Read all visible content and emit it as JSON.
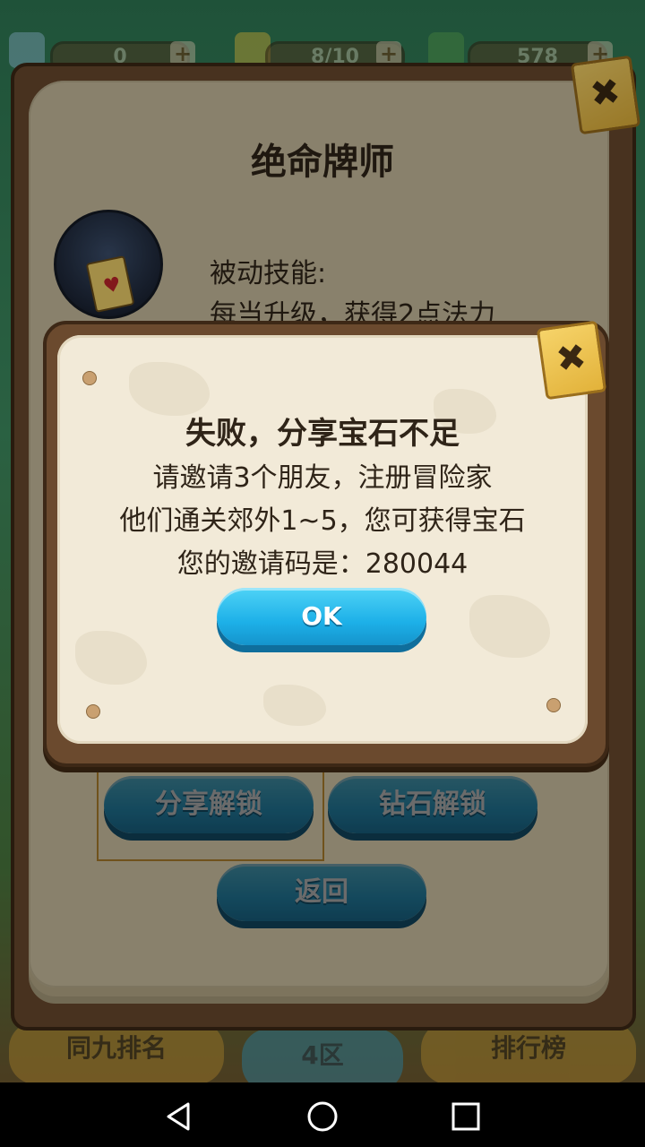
{
  "topbar": {
    "gems": "0",
    "energy": "8/10",
    "cash": "578",
    "plus": "+"
  },
  "bottom_tabs": {
    "left": "同九排名",
    "middle": "4区",
    "right": "排行榜"
  },
  "book": {
    "title": "绝命牌师",
    "skill_label": "被动技能:",
    "skill_desc": "每当升级，获得2点法力",
    "share_unlock": "分享解锁",
    "diamond_unlock": "钻石解锁",
    "back": "返回",
    "close_icon": "close-icon"
  },
  "dialog": {
    "title": "失败，分享宝石不足",
    "line1": "请邀请3个朋友，注册冒险家",
    "line2": "他们通关郊外1~5，您可获得宝石",
    "line3": "您的邀请码是：280044",
    "ok": "OK",
    "close_icon": "close-icon"
  },
  "colors": {
    "accent_blue": "#1db0e8",
    "wood": "#6b4a2e",
    "parchment": "#f2ead8"
  }
}
